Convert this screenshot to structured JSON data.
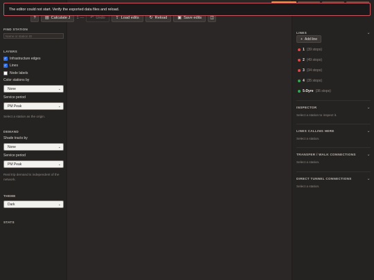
{
  "banner": {
    "message": "The editor could not start. Verify the exported data files and reload."
  },
  "top_accents": [
    {
      "color": "#e8904a"
    },
    {
      "color": "#6a4a3e"
    },
    {
      "color": "#6a4a3e"
    },
    {
      "color": "#6a4a3e"
    }
  ],
  "toolbar": {
    "help_label": "?",
    "calculate_label": "Calculate J",
    "counter": "1 —",
    "undo_label": "Undo",
    "load_label": "Load edits",
    "reload_label": "Reload",
    "save_label": "Save edits",
    "extra_icon": "panel-icon"
  },
  "left": {
    "find_station": {
      "heading": "FIND STATION",
      "placeholder": "Name or station ID"
    },
    "layers": {
      "heading": "LAYERS",
      "checkboxes": [
        {
          "label": "Infrastructure edges",
          "checked": true
        },
        {
          "label": "Lines",
          "checked": true
        },
        {
          "label": "Node labels",
          "checked": false
        }
      ],
      "color_stations_label": "Color stations by",
      "color_stations_value": "None",
      "service_period_label": "Service period",
      "service_period_value": "PM Peak",
      "hint": "Select a station as the origin."
    },
    "demand": {
      "heading": "DEMAND",
      "shade_label": "Shade tracts by",
      "shade_value": "None",
      "service_period_label": "Service period",
      "service_period_value": "PM Peak",
      "hint": "Real trip demand is independent of the network."
    },
    "theme": {
      "heading": "THEME",
      "value": "Dark"
    },
    "stats": {
      "heading": "STATS"
    }
  },
  "right": {
    "lines": {
      "heading": "LINES",
      "add_label": "Add line",
      "items": [
        {
          "name": "1",
          "stops": "(39 stops)",
          "color": "#e04848"
        },
        {
          "name": "2",
          "stops": "(49 stops)",
          "color": "#e04848"
        },
        {
          "name": "3",
          "stops": "(34 stops)",
          "color": "#e04848"
        },
        {
          "name": "4",
          "stops": "(35 stops)",
          "color": "#2fa84f"
        },
        {
          "name": "5-Dyre",
          "stops": "(36 stops)",
          "color": "#2fa84f"
        }
      ]
    },
    "inspector": {
      "heading": "INSPECTOR",
      "body": "Select a station to inspect it."
    },
    "lines_calling": {
      "heading": "LINES CALLING HERE",
      "body": "Select a station."
    },
    "transfer": {
      "heading": "TRANSFER / WALK CONNECTIONS",
      "body": "Select a station."
    },
    "tunnel": {
      "heading": "DIRECT TUNNEL CONNECTIONS",
      "body": "Select a station."
    }
  }
}
